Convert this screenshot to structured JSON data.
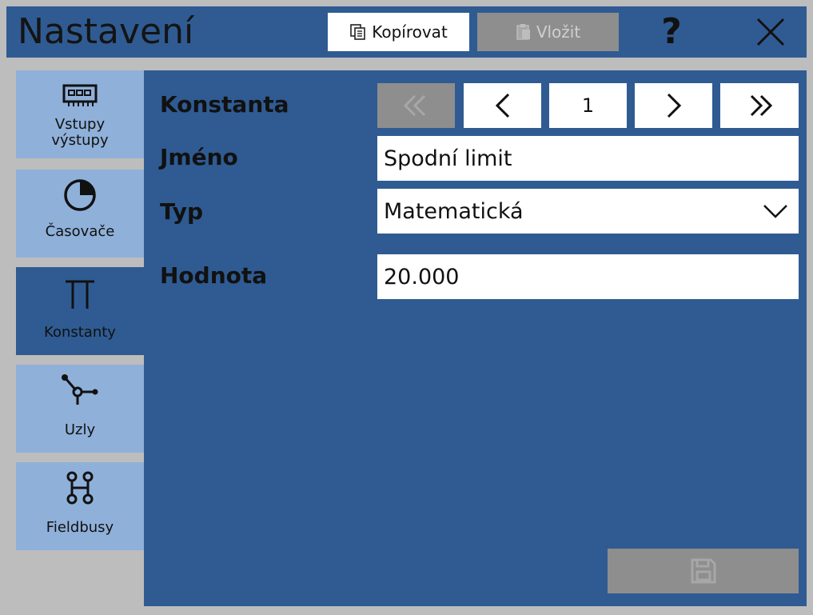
{
  "window": {
    "title": "Nastavení",
    "copy_label": "Kopírovat",
    "paste_label": "Vložit",
    "help_label": "?"
  },
  "sidebar": {
    "items": [
      {
        "label": "Vstupy\nvýstupy",
        "icon": "io-board-icon",
        "active": false
      },
      {
        "label": "Časovače",
        "icon": "timer-icon",
        "active": false
      },
      {
        "label": "Konstanty",
        "icon": "pi-icon",
        "active": true
      },
      {
        "label": "Uzly",
        "icon": "node-icon",
        "active": false
      },
      {
        "label": "Fieldbusy",
        "icon": "fieldbus-icon",
        "active": false
      }
    ]
  },
  "form": {
    "constant_label": "Konstanta",
    "name_label": "Jméno",
    "type_label": "Typ",
    "value_label": "Hodnota",
    "pager": {
      "current": "1"
    },
    "name_value": "Spodní limit",
    "type_value": "Matematická",
    "value_value": "20.000"
  },
  "colors": {
    "accent": "#2f5b92",
    "sidebar_inactive": "#8fb0d9",
    "disabled": "#8e8e8e",
    "background": "#bdbdbd"
  }
}
